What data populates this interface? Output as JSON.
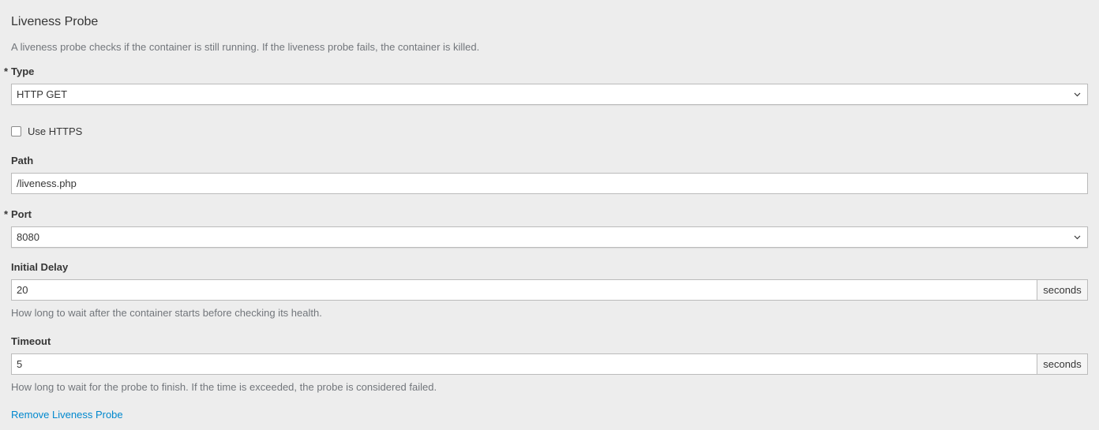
{
  "section": {
    "title": "Liveness Probe",
    "description": "A liveness probe checks if the container is still running. If the liveness probe fails, the container is killed."
  },
  "type": {
    "required_marker": "*",
    "label": "Type",
    "selected": "HTTP GET"
  },
  "use_https": {
    "label": "Use HTTPS",
    "checked": false
  },
  "path": {
    "label": "Path",
    "value": "/liveness.php"
  },
  "port": {
    "required_marker": "*",
    "label": "Port",
    "selected": "8080"
  },
  "initial_delay": {
    "label": "Initial Delay",
    "value": "20",
    "unit": "seconds",
    "help": "How long to wait after the container starts before checking its health."
  },
  "timeout": {
    "label": "Timeout",
    "value": "5",
    "unit": "seconds",
    "help": "How long to wait for the probe to finish. If the time is exceeded, the probe is considered failed."
  },
  "remove_link": "Remove Liveness Probe",
  "icons": {
    "select_chevron": "chevron-down-icon"
  },
  "colors": {
    "background": "#ededed",
    "link": "#0088ce",
    "help_text": "#72767b"
  }
}
